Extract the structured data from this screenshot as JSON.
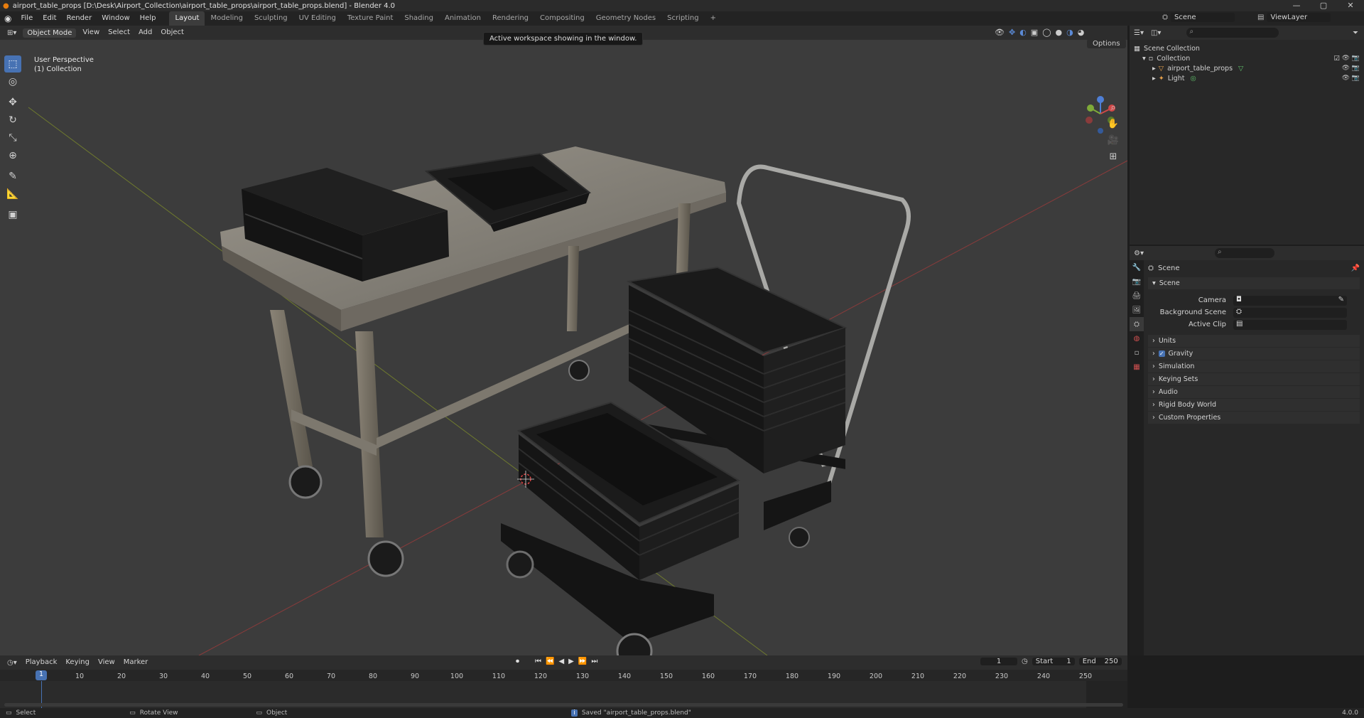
{
  "window": {
    "title": "airport_table_props [D:\\Desk\\Airport_Collection\\airport_table_props\\airport_table_props.blend] - Blender 4.0"
  },
  "menus": [
    "File",
    "Edit",
    "Render",
    "Window",
    "Help"
  ],
  "workspaces": [
    "Layout",
    "Modeling",
    "Sculpting",
    "UV Editing",
    "Texture Paint",
    "Shading",
    "Animation",
    "Rendering",
    "Compositing",
    "Geometry Nodes",
    "Scripting"
  ],
  "active_workspace": "Layout",
  "scene_selector": {
    "label": "Scene",
    "view_layer": "ViewLayer"
  },
  "viewport": {
    "mode": "Object Mode",
    "menus": [
      "View",
      "Select",
      "Add",
      "Object"
    ],
    "perspective_label": "User Perspective",
    "collection_label": "(1) Collection",
    "tooltip": "Active workspace showing in the window.",
    "options_label": "Options",
    "tools": [
      "select-box",
      "cursor",
      "move",
      "rotate",
      "scale",
      "transform",
      "annotate",
      "measure",
      "add-cube"
    ]
  },
  "outliner": {
    "root": "Scene Collection",
    "items": [
      {
        "name": "Collection",
        "depth": 1,
        "icon": "collection-icon"
      },
      {
        "name": "airport_table_props",
        "depth": 2,
        "icon": "mesh-icon"
      },
      {
        "name": "Light",
        "depth": 2,
        "icon": "light-icon"
      }
    ]
  },
  "properties": {
    "context": "Scene",
    "section": "Scene",
    "fields": [
      {
        "label": "Camera"
      },
      {
        "label": "Background Scene"
      },
      {
        "label": "Active Clip"
      }
    ],
    "panels": [
      "Units",
      "Gravity",
      "Simulation",
      "Keying Sets",
      "Audio",
      "Rigid Body World",
      "Custom Properties"
    ],
    "gravity_checked": true
  },
  "timeline": {
    "menus": [
      "Playback",
      "Keying",
      "View",
      "Marker"
    ],
    "current_frame": "1",
    "start_label": "Start",
    "start": "1",
    "end_label": "End",
    "end": "250",
    "ticks": [
      "10",
      "20",
      "30",
      "40",
      "50",
      "60",
      "70",
      "80",
      "90",
      "100",
      "110",
      "120",
      "130",
      "140",
      "150",
      "160",
      "170",
      "180",
      "190",
      "200",
      "210",
      "220",
      "230",
      "240",
      "250"
    ]
  },
  "statusbar": {
    "select": "Select",
    "rotate": "Rotate View",
    "object": "Object",
    "message": "Saved \"airport_table_props.blend\"",
    "version": "4.0.0"
  }
}
